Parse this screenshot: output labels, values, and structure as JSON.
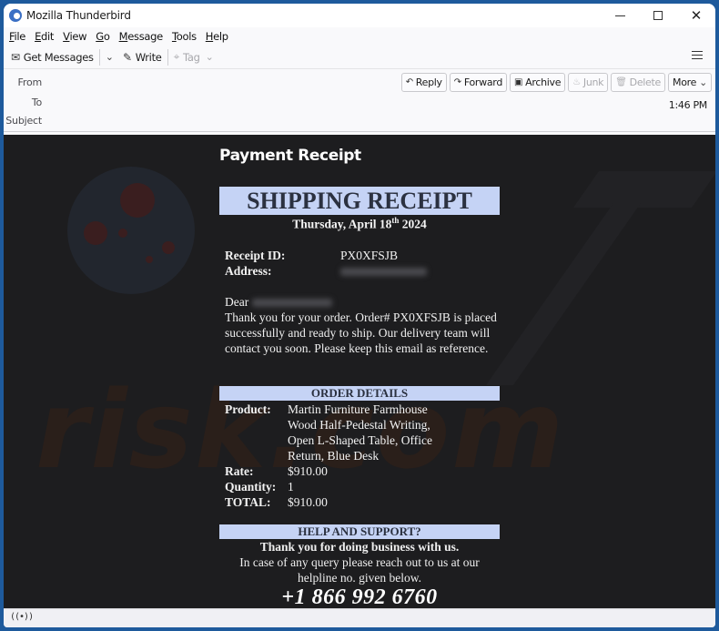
{
  "window": {
    "title": "Mozilla Thunderbird",
    "controls": {
      "minimize": "minimize-icon",
      "maximize": "maximize-icon",
      "close": "close-icon"
    }
  },
  "menubar": {
    "items": [
      {
        "label": "File",
        "mnemonic": "F",
        "rest": "ile"
      },
      {
        "label": "Edit",
        "mnemonic": "E",
        "rest": "dit"
      },
      {
        "label": "View",
        "mnemonic": "V",
        "rest": "iew"
      },
      {
        "label": "Go",
        "mnemonic": "G",
        "rest": "o"
      },
      {
        "label": "Message",
        "mnemonic": "M",
        "rest": "essage"
      },
      {
        "label": "Tools",
        "mnemonic": "T",
        "rest": "ools"
      },
      {
        "label": "Help",
        "mnemonic": "H",
        "rest": "elp"
      }
    ]
  },
  "toolbar": {
    "get_messages": "Get Messages",
    "write": "Write",
    "tag": "Tag"
  },
  "header": {
    "from_label": "From",
    "to_label": "To",
    "subject_label": "Subject",
    "time": "1:46 PM",
    "actions": {
      "reply": "Reply",
      "forward": "Forward",
      "archive": "Archive",
      "junk": "Junk",
      "delete": "Delete",
      "more": "More"
    }
  },
  "email": {
    "heading": "Payment Receipt",
    "banner_title": "SHIPPING RECEIPT",
    "date_prefix": "Thursday, April 18",
    "date_sup": "th",
    "date_suffix": " 2024",
    "receipt_id_label": "Receipt ID:",
    "receipt_id_value": "PX0XFSJB",
    "address_label": "Address:",
    "dear": "Dear",
    "message": "Thank you for your order. Order# PX0XFSJB is placed successfully and ready to ship. Our delivery team will contact you soon. Please keep this email as reference.",
    "order_details_title": "ORDER DETAILS",
    "product_label": "Product:",
    "product_lines": [
      "Martin Furniture Farmhouse",
      "Wood Half-Pedestal Writing,",
      "Open L-Shaped Table, Office",
      "Return, Blue Desk"
    ],
    "rate_label": "Rate:",
    "rate_value": "$910.00",
    "quantity_label": "Quantity:",
    "quantity_value": "1",
    "total_label": "TOTAL:",
    "total_value": "$910.00",
    "help_title": "HELP AND SUPPORT?",
    "thanks": "Thank you for doing business with us.",
    "query_line1": "In case of any query please reach out to us at our",
    "query_line2": "helpline no. given below.",
    "phone": "+1 866 992 6760"
  },
  "watermark": {
    "text": "risk.com"
  },
  "colors": {
    "banner_bg": "#c5d3f5",
    "body_bg": "#1d1d1f",
    "window_frame": "#1e5a9c"
  },
  "statusbar": {
    "icon": "connection-status-icon",
    "glyph": "((•))"
  }
}
